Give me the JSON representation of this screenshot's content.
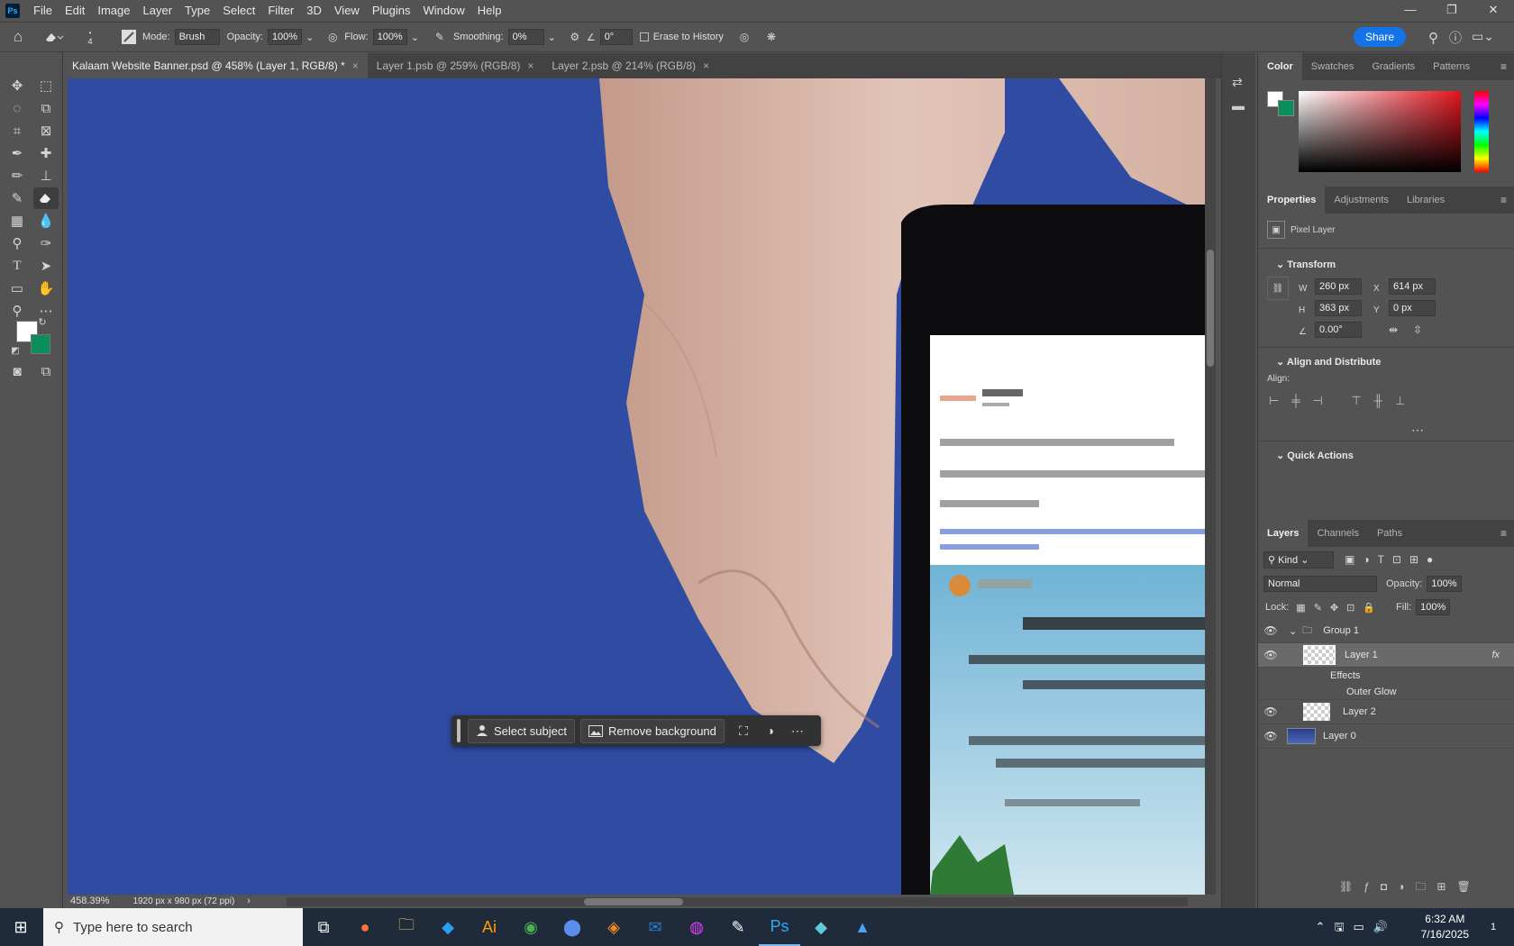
{
  "menubar": {
    "logo": "Ps",
    "items": [
      "File",
      "Edit",
      "Image",
      "Layer",
      "Type",
      "Select",
      "Filter",
      "3D",
      "View",
      "Plugins",
      "Window",
      "Help"
    ]
  },
  "options": {
    "brush_size": "4",
    "mode_label": "Mode:",
    "mode_value": "Brush",
    "opacity_label": "Opacity:",
    "opacity_value": "100%",
    "flow_label": "Flow:",
    "flow_value": "100%",
    "smoothing_label": "Smoothing:",
    "smoothing_value": "0%",
    "angle_value": "0°",
    "erase_history_label": "Erase to History",
    "share_label": "Share"
  },
  "tabs": [
    {
      "label": "Kalaam Website Banner.psd @ 458% (Layer 1, RGB/8) *"
    },
    {
      "label": "Layer 1.psb @ 259% (RGB/8)"
    },
    {
      "label": "Layer 2.psb @ 214% (RGB/8)"
    }
  ],
  "context_bar": {
    "select_subject": "Select subject",
    "remove_background": "Remove background"
  },
  "status": {
    "zoom": "458.39%",
    "doc_size": "1920 px x 980 px (72 ppi)"
  },
  "color_panel": {
    "tabs": [
      "Color",
      "Swatches",
      "Gradients",
      "Patterns"
    ],
    "foreground": "#ffffff",
    "background": "#0a8f5a"
  },
  "properties": {
    "tabs": [
      "Properties",
      "Adjustments",
      "Libraries"
    ],
    "layer_type": "Pixel Layer",
    "transform_title": "Transform",
    "w_label": "W",
    "w_value": "260 px",
    "x_label": "X",
    "x_value": "614 px",
    "h_label": "H",
    "h_value": "363 px",
    "y_label": "Y",
    "y_value": "0 px",
    "angle_value": "0.00°",
    "align_title": "Align and Distribute",
    "align_label": "Align:",
    "quick_actions_title": "Quick Actions"
  },
  "layers_panel": {
    "tabs": [
      "Layers",
      "Channels",
      "Paths"
    ],
    "kind_label": "Kind",
    "blend_mode": "Normal",
    "opacity_label": "Opacity:",
    "opacity_value": "100%",
    "lock_label": "Lock:",
    "fill_label": "Fill:",
    "fill_value": "100%",
    "layers": [
      {
        "name": "Group 1"
      },
      {
        "name": "Layer 1",
        "fx": "fx"
      },
      {
        "name": "Effects"
      },
      {
        "name": "Outer Glow"
      },
      {
        "name": "Layer 2"
      },
      {
        "name": "Layer 0"
      }
    ]
  },
  "taskbar": {
    "search_placeholder": "Type here to search",
    "time": "6:32 AM",
    "date": "7/16/2025",
    "notification_count": "1"
  }
}
